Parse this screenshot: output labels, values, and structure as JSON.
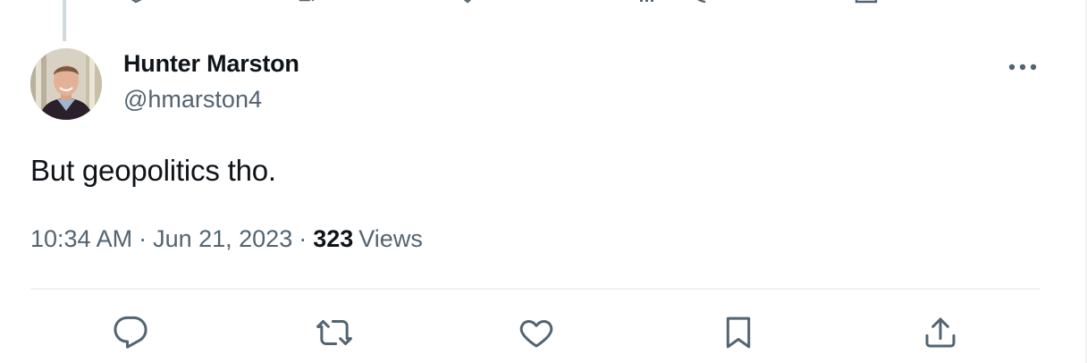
{
  "tweet": {
    "author": {
      "display_name": "Hunter Marston",
      "handle": "@hmarston4"
    },
    "text": "But geopolitics tho.",
    "time": "10:34 AM",
    "separator": "·",
    "date": "Jun 21, 2023",
    "views_count": "323",
    "views_label": "Views"
  },
  "icons": {
    "more": "more-dots-icon",
    "reply": "reply-icon",
    "retweet": "retweet-icon",
    "like": "heart-icon",
    "bookmark": "bookmark-icon",
    "share": "share-icon"
  },
  "colors": {
    "primary_text": "#0f1419",
    "secondary_text": "#536471",
    "icon": "#536471",
    "divider": "#eff3f4",
    "thread_line": "#cfd9de"
  }
}
